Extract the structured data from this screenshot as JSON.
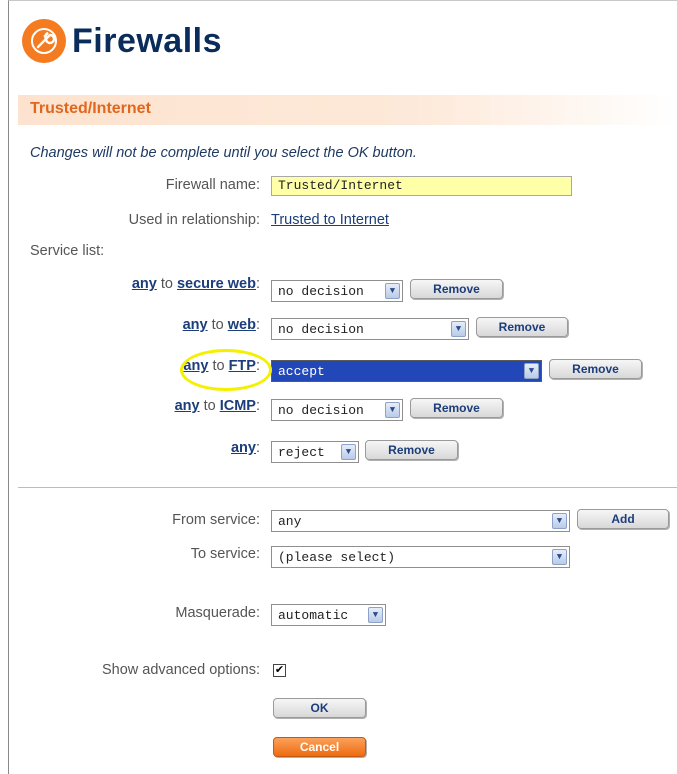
{
  "header": {
    "title": "Firewalls",
    "logo_icon": "wrench-icon",
    "logo_color": "#f47b20"
  },
  "section": {
    "title": "Trusted/Internet"
  },
  "notice": "Changes will not be complete until you select the OK button.",
  "form": {
    "firewall_name_label": "Firewall name:",
    "firewall_name_value": "Trusted/Internet",
    "relationship_label": "Used in relationship:",
    "relationship_link": "Trusted to Internet",
    "service_list_label": "Service list:"
  },
  "services": [
    {
      "from": "any",
      "to_word": " to ",
      "to": "secure web",
      "colon": ":",
      "decision": "no decision",
      "remove": "Remove"
    },
    {
      "from": "any",
      "to_word": " to ",
      "to": "web",
      "colon": ":",
      "decision": "no decision",
      "remove": "Remove"
    },
    {
      "from": "any",
      "to_word": " to ",
      "to": "FTP",
      "colon": ":",
      "decision": "accept",
      "remove": "Remove"
    },
    {
      "from": "any",
      "to_word": " to ",
      "to": "ICMP",
      "colon": ":",
      "decision": "no decision",
      "remove": "Remove"
    },
    {
      "from": "any",
      "to_word": "",
      "to": "",
      "colon": ":",
      "decision": "reject",
      "remove": "Remove"
    }
  ],
  "add": {
    "from_label": "From service:",
    "from_value": "any",
    "add_button": "Add",
    "to_label": "To service:",
    "to_value": "(please select)"
  },
  "masquerade": {
    "label": "Masquerade:",
    "value": "automatic"
  },
  "advanced": {
    "label": "Show advanced options:",
    "checked": true,
    "check_glyph": "✔"
  },
  "buttons": {
    "ok": "OK",
    "cancel": "Cancel"
  },
  "colors": {
    "accent": "#e2661b",
    "title": "#0a2c5a",
    "link": "#1b3d7a",
    "name_field_bg": "#ffffa8",
    "selected_bg": "#2147b8",
    "annotation_ring": "#f4f000"
  }
}
